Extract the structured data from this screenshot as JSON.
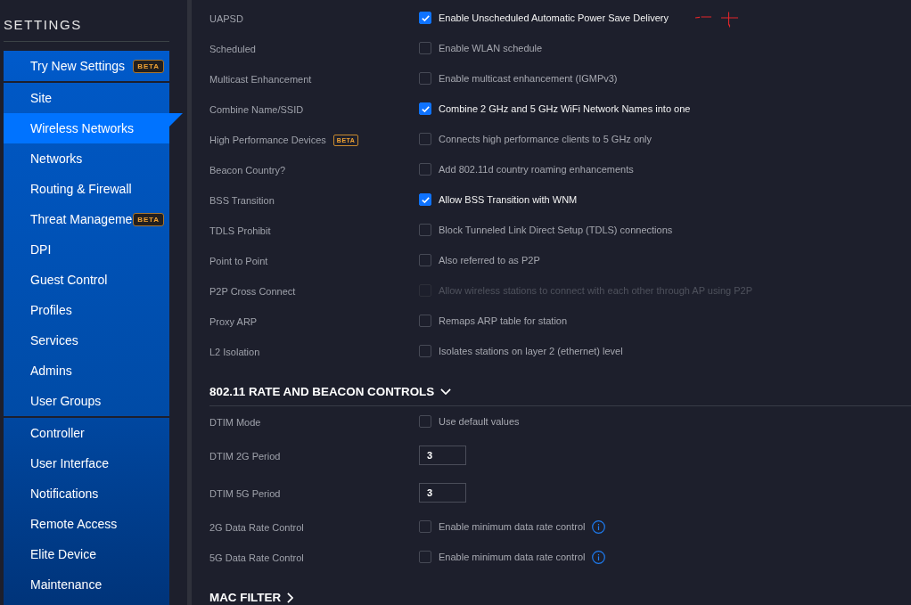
{
  "sidebar": {
    "title": "SETTINGS",
    "groups": [
      {
        "items": [
          {
            "label": "Try New Settings",
            "badge": "BETA",
            "selected": false
          }
        ]
      },
      {
        "items": [
          {
            "label": "Site",
            "selected": false
          },
          {
            "label": "Wireless Networks",
            "selected": true
          },
          {
            "label": "Networks",
            "selected": false
          },
          {
            "label": "Routing & Firewall",
            "selected": false
          },
          {
            "label": "Threat Manageme",
            "badge": "BETA",
            "selected": false
          },
          {
            "label": "DPI",
            "selected": false
          },
          {
            "label": "Guest Control",
            "selected": false
          },
          {
            "label": "Profiles",
            "selected": false
          },
          {
            "label": "Services",
            "selected": false
          },
          {
            "label": "Admins",
            "selected": false
          },
          {
            "label": "User Groups",
            "selected": false
          }
        ]
      },
      {
        "items": [
          {
            "label": "Controller",
            "selected": false
          },
          {
            "label": "User Interface",
            "selected": false
          },
          {
            "label": "Notifications",
            "selected": false
          },
          {
            "label": "Remote Access",
            "selected": false
          },
          {
            "label": "Elite Device",
            "selected": false
          },
          {
            "label": "Maintenance",
            "selected": false
          }
        ]
      }
    ]
  },
  "settings": [
    {
      "label": "UAPSD",
      "kind": "checkbox",
      "checked": true,
      "disabled": false,
      "text": "Enable Unscheduled Automatic Power Save Delivery"
    },
    {
      "label": "Scheduled",
      "kind": "checkbox",
      "checked": false,
      "disabled": false,
      "text": "Enable WLAN schedule"
    },
    {
      "label": "Multicast Enhancement",
      "kind": "checkbox",
      "checked": false,
      "disabled": false,
      "text": "Enable multicast enhancement (IGMPv3)"
    },
    {
      "label": "Combine Name/SSID",
      "kind": "checkbox",
      "checked": true,
      "disabled": false,
      "text": "Combine 2 GHz and 5 GHz WiFi Network Names into one"
    },
    {
      "label": "High Performance Devices",
      "badge": "BETA",
      "kind": "checkbox",
      "checked": false,
      "disabled": false,
      "text": "Connects high performance clients to 5 GHz only"
    },
    {
      "label": "Beacon Country?",
      "kind": "checkbox",
      "checked": false,
      "disabled": false,
      "text": "Add 802.11d country roaming enhancements"
    },
    {
      "label": "BSS Transition",
      "kind": "checkbox",
      "checked": true,
      "disabled": false,
      "text": "Allow BSS Transition with WNM"
    },
    {
      "label": "TDLS Prohibit",
      "kind": "checkbox",
      "checked": false,
      "disabled": false,
      "text": "Block Tunneled Link Direct Setup (TDLS) connections"
    },
    {
      "label": "Point to Point",
      "kind": "checkbox",
      "checked": false,
      "disabled": false,
      "text": "Also referred to as P2P"
    },
    {
      "label": "P2P Cross Connect",
      "kind": "checkbox",
      "checked": false,
      "disabled": true,
      "text": "Allow wireless stations to connect with each other through AP using P2P"
    },
    {
      "label": "Proxy ARP",
      "kind": "checkbox",
      "checked": false,
      "disabled": false,
      "text": "Remaps ARP table for station"
    },
    {
      "label": "L2 Isolation",
      "kind": "checkbox",
      "checked": false,
      "disabled": false,
      "text": "Isolates stations on layer 2 (ethernet) level"
    }
  ],
  "sections": [
    {
      "title": "802.11 RATE AND BEACON CONTROLS",
      "expanded": true,
      "rows": [
        {
          "label": "DTIM Mode",
          "kind": "checkbox",
          "checked": false,
          "disabled": false,
          "info": false,
          "text": "Use default values"
        },
        {
          "label": "DTIM 2G Period",
          "kind": "input",
          "value": "3"
        },
        {
          "label": "DTIM 5G Period",
          "kind": "input",
          "value": "3"
        },
        {
          "label": "2G Data Rate Control",
          "kind": "checkbox",
          "checked": false,
          "disabled": false,
          "info": true,
          "text": "Enable minimum data rate control"
        },
        {
          "label": "5G Data Rate Control",
          "kind": "checkbox",
          "checked": false,
          "disabled": false,
          "info": true,
          "text": "Enable minimum data rate control"
        }
      ]
    },
    {
      "title": "MAC FILTER",
      "expanded": false
    }
  ]
}
